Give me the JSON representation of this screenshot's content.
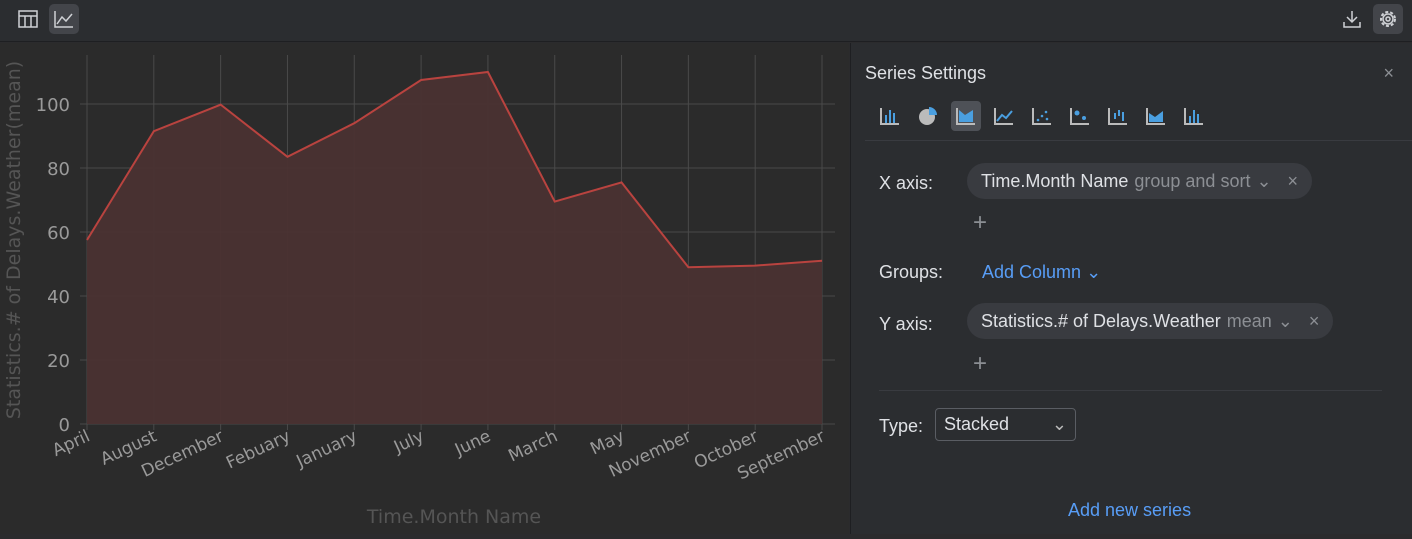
{
  "toolbar": {
    "table_view": "table-icon",
    "chart_view": "chart-icon",
    "download": "download-icon",
    "settings": "gear-icon"
  },
  "chart_data": {
    "type": "area",
    "title": "",
    "xlabel": "Time.Month Name",
    "ylabel": "Statistics.# of Delays.Weather(mean)",
    "categories": [
      "April",
      "August",
      "December",
      "Febuary",
      "January",
      "July",
      "June",
      "March",
      "May",
      "November",
      "October",
      "September"
    ],
    "values": [
      57.5,
      91.5,
      99.8,
      83.5,
      94,
      107.5,
      110,
      69.5,
      75.5,
      49,
      49.5,
      51
    ],
    "ylim": [
      0,
      115
    ],
    "yticks": [
      0,
      20,
      40,
      60,
      80,
      100
    ],
    "grid": true,
    "colors": {
      "line": "#b9433f",
      "fill": "#4a3131"
    }
  },
  "panel": {
    "title": "Series Settings",
    "close": "×",
    "x_axis_label": "X axis:",
    "x_axis_field": "Time.Month Name",
    "x_axis_hint": "group and sort",
    "groups_label": "Groups:",
    "add_column": "Add Column",
    "y_axis_label": "Y axis:",
    "y_axis_field": "Statistics.# of Delays.Weather",
    "y_axis_hint": "mean",
    "type_label": "Type:",
    "type_value": "Stacked",
    "add_series": "Add new series",
    "plus": "+",
    "remove": "×"
  }
}
